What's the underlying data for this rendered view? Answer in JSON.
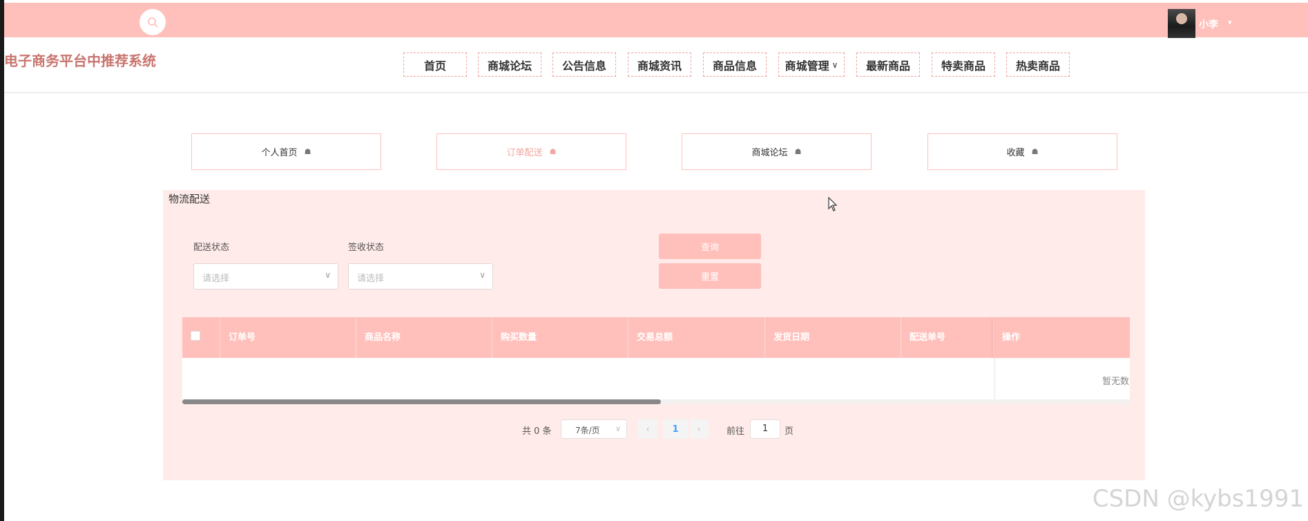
{
  "header": {
    "user_name": "小李",
    "site_title": "电子商务平台中推荐系统",
    "search_icon": "search-icon",
    "nav": [
      {
        "label": "首页"
      },
      {
        "label": "商城论坛"
      },
      {
        "label": "公告信息"
      },
      {
        "label": "商城资讯"
      },
      {
        "label": "商品信息"
      },
      {
        "label": "商城管理"
      },
      {
        "label": "最新商品"
      },
      {
        "label": "特卖商品"
      },
      {
        "label": "热卖商品"
      }
    ],
    "colors": {
      "top_bar": "#ffc0bb",
      "title": "#c8746e"
    }
  },
  "tabs": [
    {
      "label": "个人首页",
      "active": false
    },
    {
      "label": "订单配送",
      "active": true
    },
    {
      "label": "商城论坛",
      "active": false
    },
    {
      "label": "收藏",
      "active": false
    }
  ],
  "panel": {
    "title": "物流配送",
    "filters": [
      {
        "label": "配送状态",
        "placeholder": "请选择"
      },
      {
        "label": "签收状态",
        "placeholder": "请选择"
      }
    ],
    "buttons": {
      "query": "查询",
      "reset": "重置"
    },
    "table": {
      "columns": [
        "订单号",
        "商品名称",
        "购买数量",
        "交易总额",
        "发货日期",
        "配送单号",
        "操作"
      ],
      "rows": [],
      "empty_text": "暂无数"
    },
    "pagination": {
      "total_text": "共 0 条",
      "page_size": "7条/页",
      "current_page": "1",
      "goto_label": "前往",
      "goto_value": "1",
      "page_unit": "页"
    }
  },
  "watermark": "CSDN @kybs1991"
}
